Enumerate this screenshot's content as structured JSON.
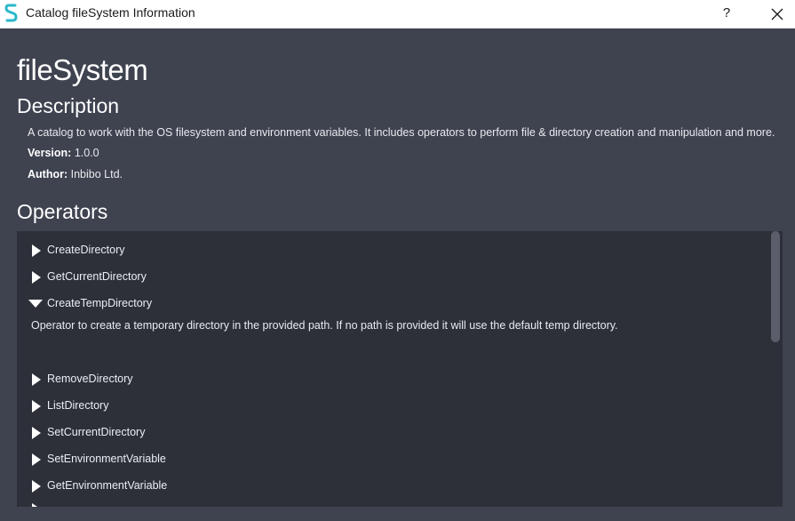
{
  "window": {
    "title": "Catalog fileSystem Information",
    "help_label": "?",
    "app_icon": "s-logo-icon",
    "close_icon": "close-icon"
  },
  "catalog": {
    "name": "fileSystem",
    "description_heading": "Description",
    "description": "A catalog to work with the OS filesystem and environment variables. It includes operators to perform file & directory creation and manipulation and more.",
    "version_label": "Version:",
    "version": "1.0.0",
    "author_label": "Author:",
    "author": "Inbibo Ltd."
  },
  "operators": {
    "heading": "Operators",
    "items": [
      {
        "label": "CreateDirectory",
        "expanded": false
      },
      {
        "label": "GetCurrentDirectory",
        "expanded": false
      },
      {
        "label": "CreateTempDirectory",
        "expanded": true,
        "detail": "Operator to create a temporary directory in the provided path. If no path is provided it will use the default temp directory."
      },
      {
        "label": "RemoveDirectory",
        "expanded": false
      },
      {
        "label": "ListDirectory",
        "expanded": false
      },
      {
        "label": "SetCurrentDirectory",
        "expanded": false
      },
      {
        "label": "SetEnvironmentVariable",
        "expanded": false
      },
      {
        "label": "GetEnvironmentVariable",
        "expanded": false
      }
    ]
  },
  "colors": {
    "background": "#3f4350",
    "panel": "#2d3039",
    "titlebar": "#ffffff",
    "icon_accent": "#2ab7c9"
  }
}
